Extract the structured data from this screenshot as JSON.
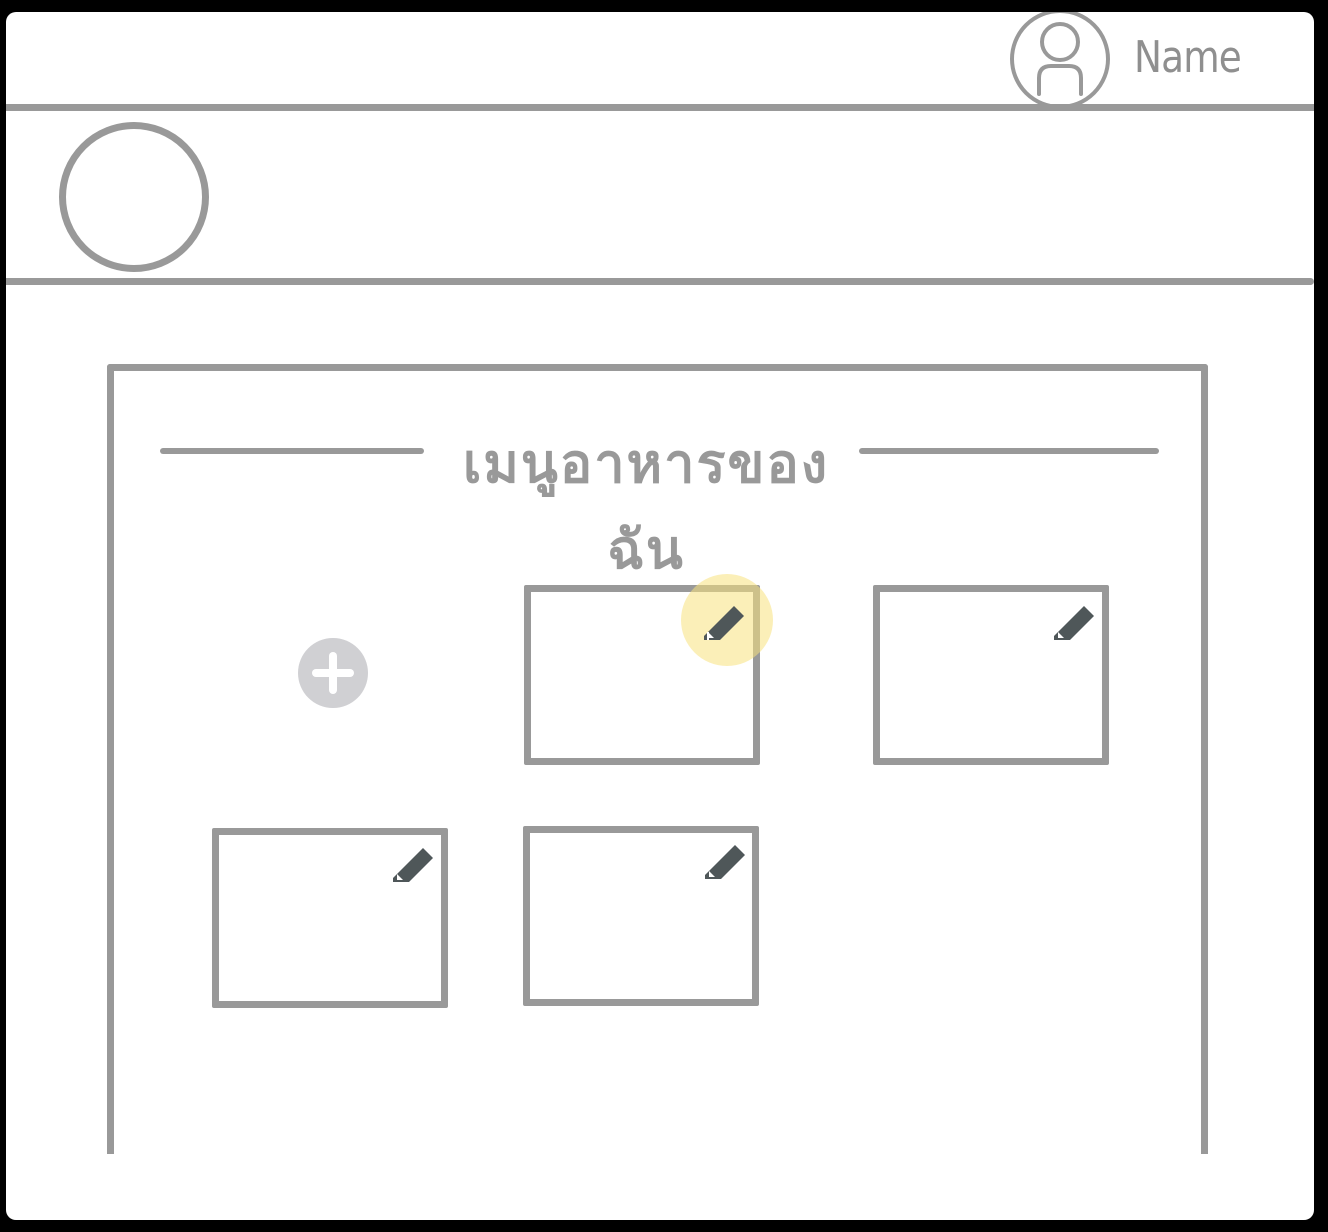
{
  "header": {
    "user_name": "Name"
  },
  "menu": {
    "title": "เมนูอาหารของฉัน"
  },
  "colors": {
    "line": "#999999",
    "pencil": "#4f5759",
    "highlight": "#f7e17d",
    "add_button": "#d0d0d3"
  },
  "icons": {
    "profile": "user-circle-icon",
    "add": "plus-icon",
    "edit": "pencil-icon"
  }
}
